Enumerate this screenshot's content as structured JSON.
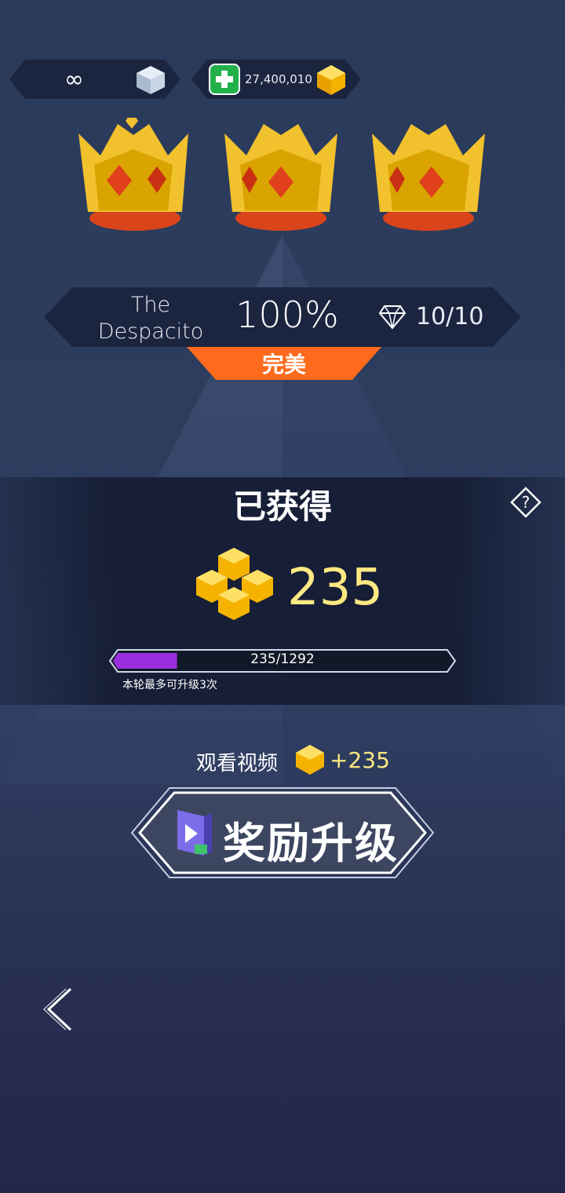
{
  "hud": {
    "lives_symbol": "∞",
    "lives_icon": "cube-icon",
    "add_icon": "plus-icon",
    "gem_count": "27,400,010",
    "gem_icon": "gem-icon"
  },
  "crowns": {
    "earned": 3,
    "total": 3,
    "icon": "crown-icon"
  },
  "song": {
    "title_line1": "The",
    "title_line2": "Despacito",
    "percent": "100%",
    "diamonds": "10/10",
    "rating": "完美"
  },
  "earned": {
    "title": "已获得",
    "value": "235",
    "progress_text": "235/1292",
    "progress_fraction": 0.18,
    "note": "本轮最多可升级3次"
  },
  "video": {
    "label": "观看视频",
    "bonus": "+235"
  },
  "reward_button": {
    "label": "奖励升级"
  },
  "colors": {
    "accent_orange": "#ff6a1c",
    "gold_text": "#ffe982",
    "progress_purple": "#9b2fe0",
    "plus_green": "#22b04a"
  }
}
